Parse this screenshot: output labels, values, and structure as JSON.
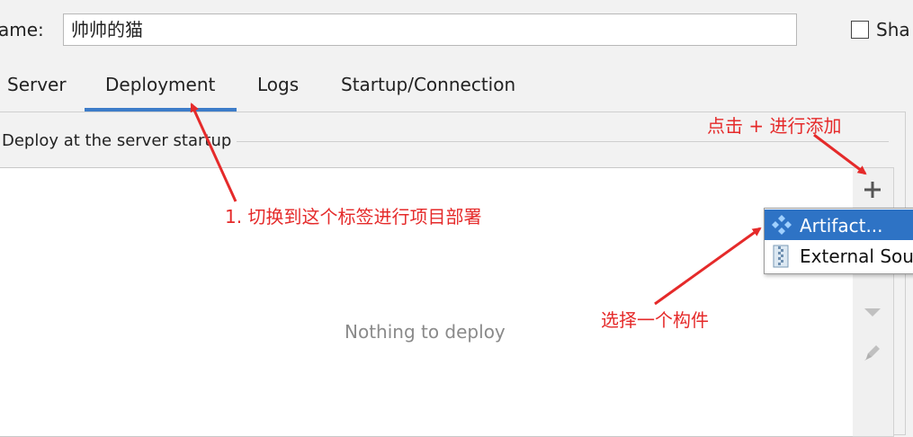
{
  "header": {
    "name_label": "ame:",
    "name_value": "帅帅的猫",
    "share_label": "Sha"
  },
  "tabs": [
    {
      "label": "Server",
      "active": false
    },
    {
      "label": "Deployment",
      "active": true
    },
    {
      "label": "Logs",
      "active": false
    },
    {
      "label": "Startup/Connection",
      "active": false
    }
  ],
  "deploy": {
    "section_title": "Deploy at the server startup",
    "empty_text": "Nothing to deploy"
  },
  "toolbar": {
    "icons": [
      "plus-icon",
      "minus-icon",
      "move-down-icon",
      "edit-icon"
    ]
  },
  "popup": {
    "items": [
      {
        "label": "Artifact...",
        "icon": "artifact-icon",
        "selected": true
      },
      {
        "label": "External Sou",
        "icon": "external-source-icon",
        "selected": false
      }
    ]
  },
  "annotations": {
    "tab_note": "1. 切换到这个标签进行项目部署",
    "plus_note": "点击 + 进行添加",
    "artifact_note": "选择一个构件"
  },
  "colors": {
    "accent": "#3d7cc9",
    "selection": "#2e73c5",
    "annotation": "#e52a2a",
    "background": "#f2f2f2"
  }
}
